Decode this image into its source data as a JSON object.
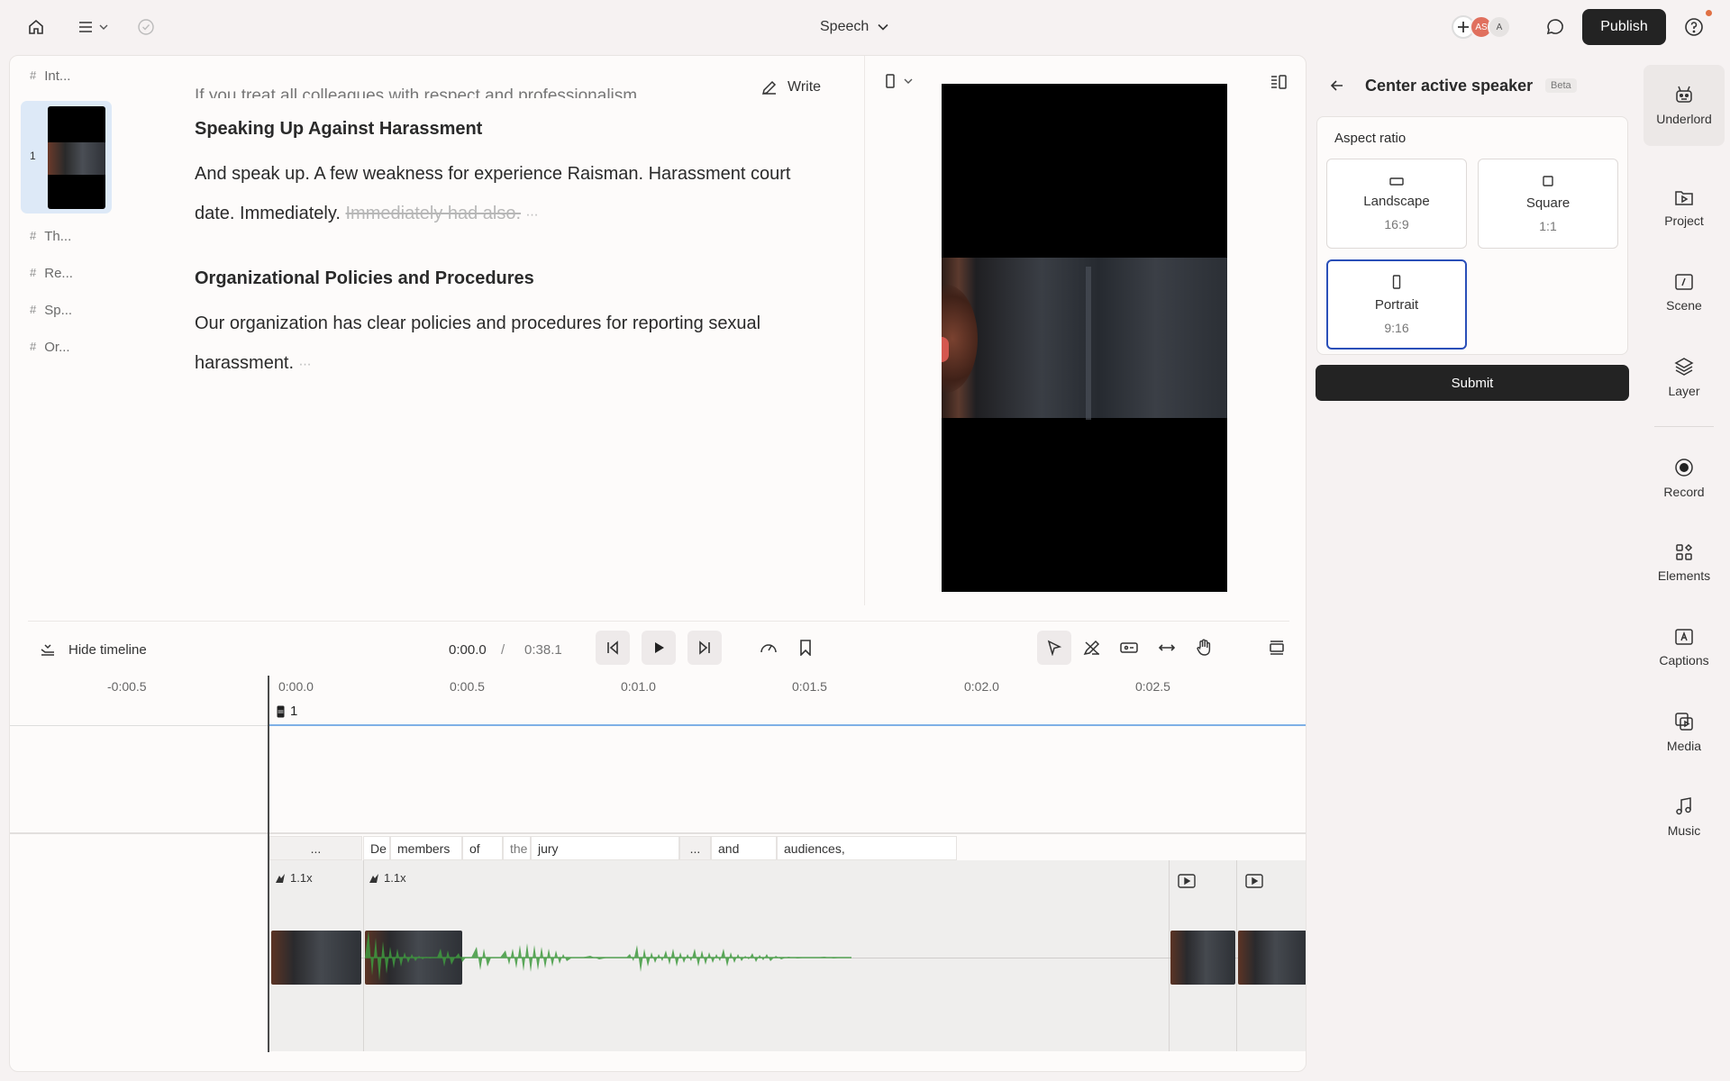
{
  "topbar": {
    "project_title": "Speech",
    "avatars": [
      "AS",
      "A"
    ],
    "publish_label": "Publish"
  },
  "outline": {
    "items_top": [
      {
        "label": "Int..."
      }
    ],
    "scene_number": "1",
    "items_bottom": [
      {
        "label": "Th..."
      },
      {
        "label": "Re..."
      },
      {
        "label": "Sp..."
      },
      {
        "label": "Or..."
      }
    ]
  },
  "script": {
    "cut_line": "If you treat all colleagues with respect and professionalism.",
    "heading1": "Speaking Up Against Harassment",
    "para1_text": "And speak up. A few weakness for experience Raisman. Harassment court date. Immediately.",
    "para1_struck": "Immediately had also.",
    "heading2": "Organizational Policies and Procedures",
    "para2_text": "Our organization has clear policies and procedures for reporting sexual harassment."
  },
  "toolbar": {
    "write_label": "Write"
  },
  "transport": {
    "hide_timeline_label": "Hide timeline",
    "current_time": "0:00.0",
    "separator": "/",
    "total_time": "0:38.1"
  },
  "timeline": {
    "ruler": [
      "-0:00.5",
      "0:00.0",
      "0:00.5",
      "0:01.0",
      "0:01.5",
      "0:02.0",
      "0:02.5"
    ],
    "scene_label": "1",
    "words": [
      "...",
      "De",
      "members",
      "of",
      "the",
      "jury",
      "...",
      "and",
      "audiences,"
    ],
    "speeds": [
      "1.1x",
      "1.1x"
    ]
  },
  "right_panel": {
    "title": "Center active speaker",
    "badge": "Beta",
    "aspect_title": "Aspect ratio",
    "options": [
      {
        "name": "Landscape",
        "ratio": "16:9"
      },
      {
        "name": "Square",
        "ratio": "1:1"
      },
      {
        "name": "Portrait",
        "ratio": "9:16"
      }
    ],
    "selected_option": "Portrait",
    "submit_label": "Submit"
  },
  "rail": {
    "items": [
      {
        "label": "Underlord",
        "icon": "underlord-icon"
      },
      {
        "label": "Project",
        "icon": "project-icon"
      },
      {
        "label": "Scene",
        "icon": "scene-icon"
      },
      {
        "label": "Layer",
        "icon": "layer-icon"
      },
      {
        "label": "Record",
        "icon": "record-icon"
      },
      {
        "label": "Elements",
        "icon": "elements-icon"
      },
      {
        "label": "Captions",
        "icon": "captions-icon"
      },
      {
        "label": "Media",
        "icon": "media-icon"
      },
      {
        "label": "Music",
        "icon": "music-icon"
      }
    ],
    "active": "Underlord"
  }
}
